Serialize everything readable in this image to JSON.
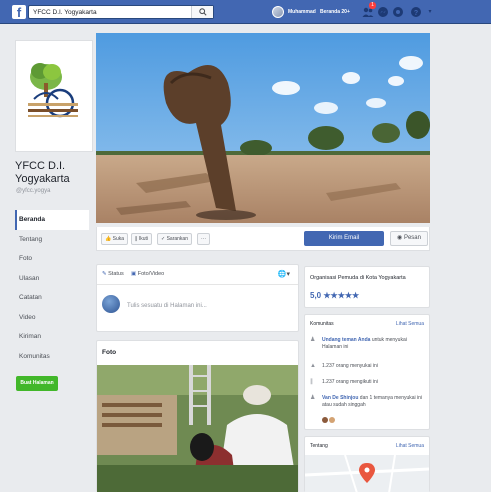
{
  "topbar": {
    "logo": "f",
    "search_value": "YFCC D.I. Yogyakarta",
    "search_icon": "magnifier-icon",
    "user_name": "Muhammad",
    "home_label": "Beranda",
    "home_count": "20+",
    "friends_badge": "1",
    "brand_color": "#4267b2"
  },
  "page": {
    "name": "YFCC D.I. Yogyakarta",
    "handle": "@yfcc.yogya"
  },
  "leftnav": {
    "items": [
      {
        "label": "Beranda"
      },
      {
        "label": "Tentang"
      },
      {
        "label": "Foto"
      },
      {
        "label": "Ulasan"
      },
      {
        "label": "Catatan"
      },
      {
        "label": "Video"
      },
      {
        "label": "Kiriman"
      },
      {
        "label": "Komunitas"
      }
    ],
    "active": "Beranda",
    "create_label": "Buat Halaman"
  },
  "actions": {
    "like": "Suka",
    "follow": "Ikuti",
    "recommend": "Sarankan",
    "more": "···",
    "send_email": "Kirim Email",
    "message": "Pesan"
  },
  "composer": {
    "tab_status": "Status",
    "tab_photo": "Foto/Video",
    "placeholder": "Tulis sesuatu di Halaman ini..."
  },
  "photos": {
    "title": "Foto"
  },
  "about": {
    "description": "Organisasi Pemuda di Kota Yogyakarta",
    "rating": "5,0",
    "stars": "★★★★★",
    "stars_count": 5
  },
  "community": {
    "title": "Komunitas",
    "see_all": "Lihat Semua",
    "invite_link": "Undang teman Anda",
    "invite_rest": "untuk menyukai Halaman ini",
    "likes": "1.237 orang menyukai ini",
    "follows": "1.237 orang mengikuti ini",
    "friend_name": "Van De Shinjou",
    "friend_rest": "dan 1 temanya menyukai ini atau sudah singgah"
  },
  "info": {
    "title": "Tentang",
    "see_all": "Lihat Semua"
  }
}
